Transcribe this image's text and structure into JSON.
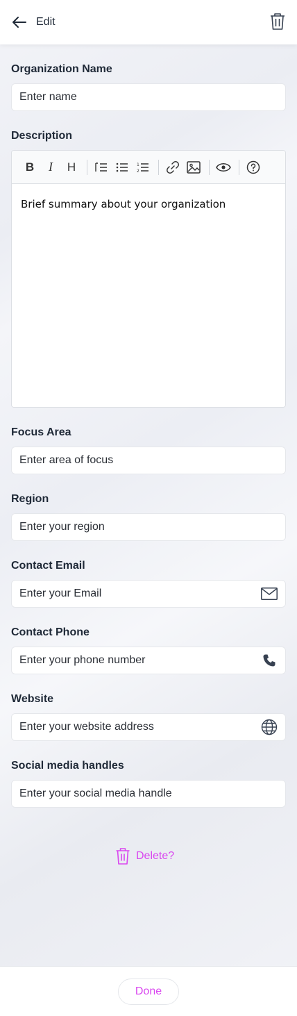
{
  "header": {
    "title": "Edit"
  },
  "fields": {
    "org_name": {
      "label": "Organization Name",
      "placeholder": "Enter name"
    },
    "description": {
      "label": "Description",
      "content": "Brief summary about your  organization"
    },
    "focus_area": {
      "label": "Focus Area",
      "placeholder": "Enter area of focus"
    },
    "region": {
      "label": "Region",
      "placeholder": "Enter your region"
    },
    "email": {
      "label": "Contact Email",
      "placeholder": "Enter your Email"
    },
    "phone": {
      "label": "Contact Phone",
      "placeholder": "Enter your phone number"
    },
    "website": {
      "label": "Website",
      "placeholder": "Enter your website address"
    },
    "social": {
      "label": "Social media handles",
      "placeholder": "Enter your social media handle"
    }
  },
  "toolbar": {
    "bold": "B",
    "italic": "I",
    "heading": "H"
  },
  "actions": {
    "delete_label": "Delete?",
    "done_label": "Done"
  },
  "colors": {
    "accent": "#d946ef",
    "text": "#1f2937",
    "border": "#e5e7eb"
  }
}
